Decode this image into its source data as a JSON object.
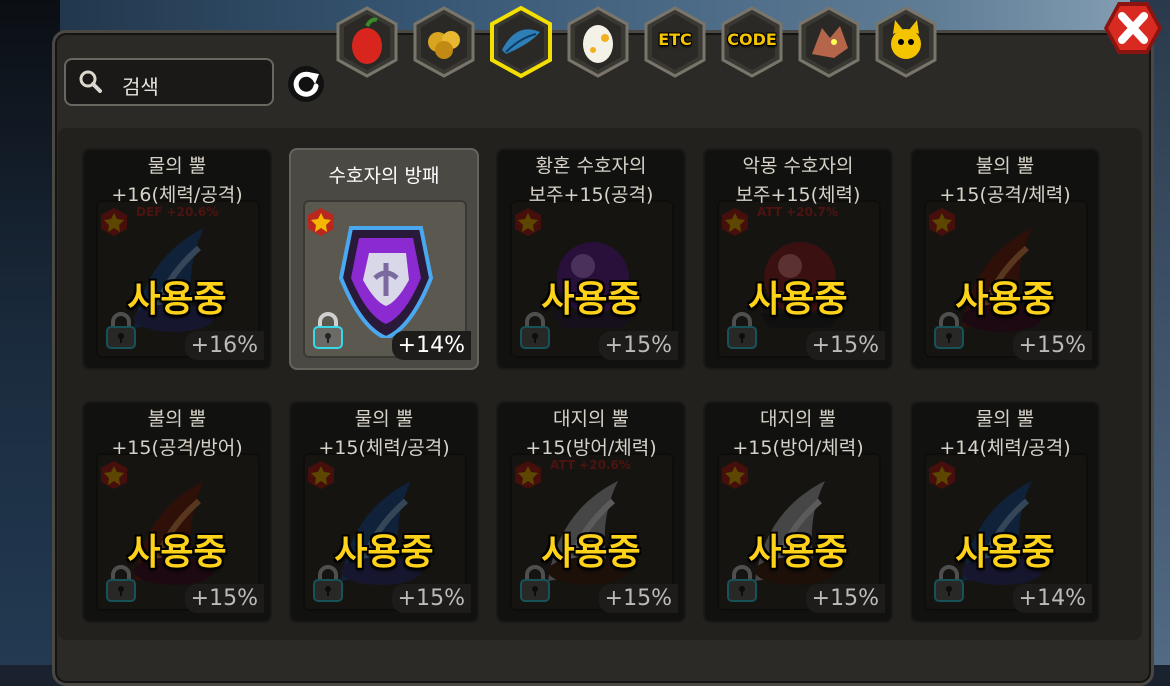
{
  "search": {
    "placeholder": "검색"
  },
  "tabs": [
    {
      "icon": "fruit-icon",
      "label": ""
    },
    {
      "icon": "gold-nugget-icon",
      "label": ""
    },
    {
      "icon": "blue-feather-icon",
      "label": "",
      "selected": true
    },
    {
      "icon": "egg-icon",
      "label": ""
    },
    {
      "icon": "etc-icon",
      "label": "ETC"
    },
    {
      "icon": "code-icon",
      "label": "CODE"
    },
    {
      "icon": "dragon-head-icon",
      "label": ""
    },
    {
      "icon": "cat-face-icon",
      "label": ""
    }
  ],
  "colors": {
    "accent": "#ffd21a",
    "tab_selected_border": "#f3e000",
    "close_red": "#d92a22"
  },
  "in_use_label": "사용중",
  "items": [
    {
      "name": "물의 뿔\n+16(체력/공격)",
      "pct": "+16%",
      "in_use": true,
      "stat": "DEF +20.6%",
      "art": "horn-blue"
    },
    {
      "name": "수호자의 방패",
      "pct": "+14%",
      "in_use": false,
      "stat": "",
      "art": "shield-purple"
    },
    {
      "name": "황혼 수호자의\n보주+15(공격)",
      "pct": "+15%",
      "in_use": true,
      "stat": "",
      "art": "orb-purple"
    },
    {
      "name": "악몽 수호자의\n보주+15(체력)",
      "pct": "+15%",
      "in_use": true,
      "stat": "ATT +20.7%",
      "art": "orb-dark"
    },
    {
      "name": "불의 뿔\n+15(공격/체력)",
      "pct": "+15%",
      "in_use": true,
      "stat": "",
      "art": "horn-fire"
    },
    {
      "name": "불의 뿔\n+15(공격/방어)",
      "pct": "+15%",
      "in_use": true,
      "stat": "",
      "art": "horn-fire"
    },
    {
      "name": "물의 뿔\n+15(체력/공격)",
      "pct": "+15%",
      "in_use": true,
      "stat": "",
      "art": "horn-blue"
    },
    {
      "name": "대지의 뿔\n+15(방어/체력)",
      "pct": "+15%",
      "in_use": true,
      "stat": "ATT +20.6%",
      "art": "horn-earth"
    },
    {
      "name": "대지의 뿔\n+15(방어/체력)",
      "pct": "+15%",
      "in_use": true,
      "stat": "",
      "art": "horn-earth"
    },
    {
      "name": "물의 뿔\n+14(체력/공격)",
      "pct": "+14%",
      "in_use": true,
      "stat": "",
      "art": "horn-blue"
    }
  ]
}
